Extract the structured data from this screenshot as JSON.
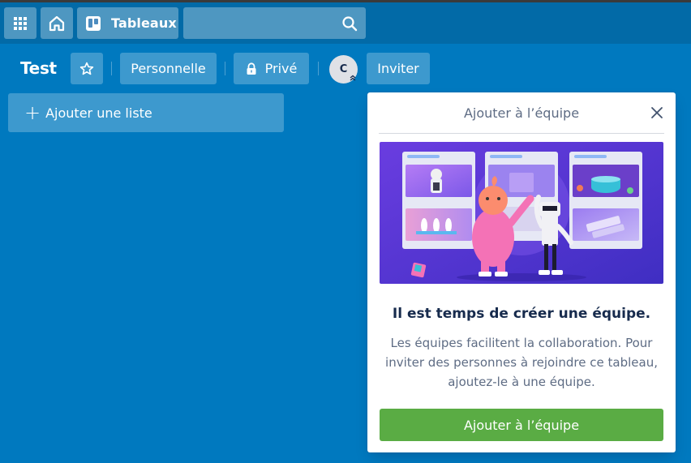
{
  "header": {
    "boards_label": "Tableaux",
    "search": {
      "value": "",
      "placeholder": ""
    }
  },
  "board": {
    "title": "Test",
    "team_label": "Personnelle",
    "visibility_label": "Privé",
    "member_initial": "C",
    "invite_label": "Inviter"
  },
  "lists": {
    "add_list_label": "Ajouter une liste"
  },
  "popover": {
    "title": "Ajouter à l’équipe",
    "heading": "Il est temps de créer une équipe.",
    "body": "Les équipes facilitent la collaboration. Pour inviter des personnes à rejoindre ce tableau, ajoutez-le à une équipe.",
    "action_label": "Ajouter à l’équipe"
  },
  "colors": {
    "board_bg": "#0079bf",
    "header_bg": "#026aa7",
    "action_green": "#5aac44",
    "illustration_bg": "#5b3fd9"
  },
  "icons": {
    "apps": "grid-icon",
    "home": "house-icon",
    "boards": "trello-board-icon",
    "search": "search-icon",
    "star": "star-icon",
    "lock": "lock-icon",
    "close": "close-icon",
    "add": "plus-icon"
  }
}
